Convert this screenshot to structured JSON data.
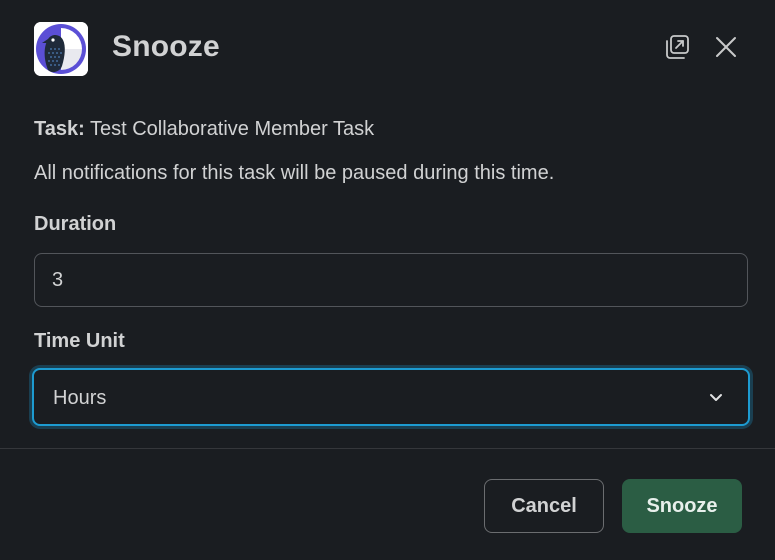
{
  "modal": {
    "title": "Snooze",
    "app_logo_icon": "bird-logo-icon"
  },
  "header_actions": {
    "popout_icon": "open-in-window-icon",
    "close_icon": "close-icon"
  },
  "task": {
    "key_label": "Task:",
    "value": "Test Collaborative Member Task"
  },
  "description": "All notifications for this task will be paused during this time.",
  "fields": {
    "duration": {
      "label": "Duration",
      "value": "3"
    },
    "time_unit": {
      "label": "Time Unit",
      "selected": "Hours",
      "chevron_icon": "chevron-down-icon"
    }
  },
  "footer": {
    "cancel_label": "Cancel",
    "submit_label": "Snooze"
  },
  "colors": {
    "background": "#1a1d21",
    "focus_ring": "#1d9bd1",
    "primary_button": "#2b5d44",
    "logo_purple": "#5b4fd6"
  }
}
